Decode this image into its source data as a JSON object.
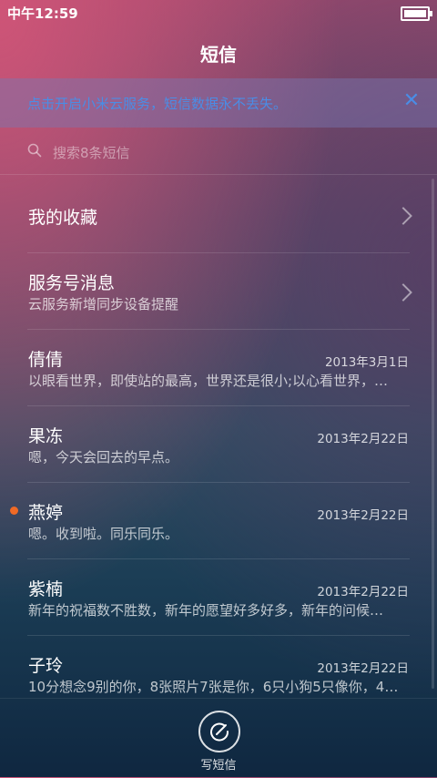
{
  "status_bar": {
    "time": "中午12:59"
  },
  "header": {
    "title": "短信"
  },
  "banner": {
    "text": "点击开启小米云服务，短信数据永不丢失。",
    "close_icon": "close-icon"
  },
  "search": {
    "placeholder": "搜索8条短信"
  },
  "list": {
    "items": [
      {
        "name": "我的收藏",
        "preview": "",
        "date": "",
        "type": "folder"
      },
      {
        "name": "服务号消息",
        "preview": "云服务新增同步设备提醒",
        "date": "",
        "type": "folder"
      },
      {
        "name": "倩倩",
        "preview": "以眼看世界，即使站的最高，世界还是很小;以心看世界，…",
        "date": "2013年3月1日",
        "type": "message"
      },
      {
        "name": "果冻",
        "preview": "嗯，今天会回去的早点。",
        "date": "2013年2月22日",
        "type": "message"
      },
      {
        "name": "燕婷",
        "preview": "嗯。收到啦。同乐同乐。",
        "date": "2013年2月22日",
        "type": "message",
        "unread": true
      },
      {
        "name": "紫楠",
        "preview": "新年的祝福数不胜数，新年的愿望好多好多，新年的问候…",
        "date": "2013年2月22日",
        "type": "message"
      },
      {
        "name": "子玲",
        "preview": "10分想念9别的你，8张照片7张是你，6只小狗5只像你，4…",
        "date": "2013年2月22日",
        "type": "message"
      }
    ]
  },
  "bottom": {
    "compose_label": "写短信"
  },
  "colors": {
    "unread": "#f06a26",
    "banner_text": "#4a8de6"
  }
}
